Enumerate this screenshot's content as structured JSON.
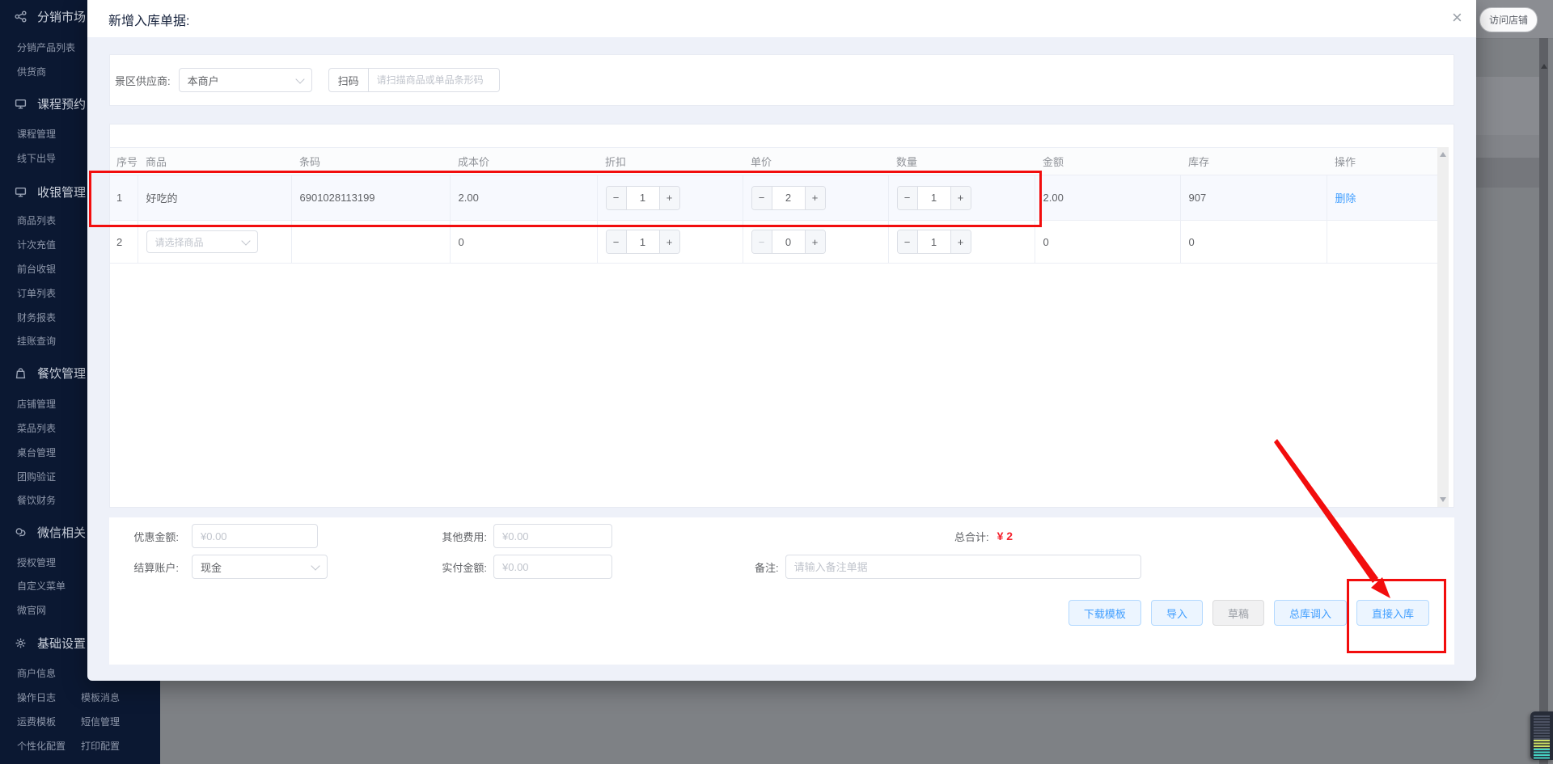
{
  "glyphs": {
    "minus": "−",
    "plus": "+",
    "close": "×"
  },
  "colors": {
    "accent": "#409eff",
    "annotation_red": "#f20d0d",
    "total_red": "#f5222d",
    "sidebar_bg": "#0b1832"
  },
  "topbar": {
    "visit_shop": "访问店铺"
  },
  "sidebar": {
    "sections": [
      {
        "icon": "share-icon",
        "label": "分销市场",
        "items": [
          "分销产品列表",
          "供货商"
        ]
      },
      {
        "icon": "monitor-icon",
        "label": "课程预约",
        "items": [
          "课程管理",
          "线下出导"
        ]
      },
      {
        "icon": "cashier-icon",
        "label": "收银管理",
        "items": [
          "商品列表",
          "计次充值",
          "前台收银",
          "订单列表",
          "财务报表",
          "挂账查询"
        ]
      },
      {
        "icon": "bag-icon",
        "label": "餐饮管理",
        "items": [
          "店铺管理",
          "菜品列表",
          "桌台管理",
          "团购验证",
          "餐饮财务"
        ]
      },
      {
        "icon": "wechat-icon",
        "label": "微信相关",
        "items": [
          "授权管理",
          "自定义菜单",
          "微官网"
        ]
      },
      {
        "icon": "gear-icon",
        "label": "基础设置",
        "items": [
          "商户信息",
          "操作日志",
          "模板消息",
          "运费模板",
          "短信管理",
          "个性化配置",
          "打印配置"
        ]
      }
    ]
  },
  "modal": {
    "title": "新增入库单据:",
    "supplier_label": "景区供应商:",
    "supplier_value": "本商户",
    "scan_button": "扫码",
    "scan_placeholder": "请扫描商品或单品条形码",
    "table": {
      "headers": [
        "序号",
        "商品",
        "条码",
        "成本价",
        "折扣",
        "单价",
        "数量",
        "金额",
        "库存",
        "操作"
      ],
      "rows": [
        {
          "no": "1",
          "product": "好吃的",
          "barcode": "6901028113199",
          "cost": "2.00",
          "discount": "1",
          "price": "2",
          "qty": "1",
          "amount": "2.00",
          "stock": "907",
          "action": "删除"
        },
        {
          "no": "2",
          "product_placeholder": "请选择商品",
          "barcode": "",
          "cost": "0",
          "discount": "1",
          "price": "0",
          "qty": "1",
          "amount": "0",
          "stock": "0",
          "action": ""
        }
      ]
    },
    "form": {
      "discount_label": "优惠金额:",
      "discount_placeholder": "¥0.00",
      "other_fee_label": "其他费用:",
      "other_fee_placeholder": "¥0.00",
      "total_label": "总合计:",
      "total_value": "¥ 2",
      "account_label": "结算账户:",
      "account_value": "现金",
      "paid_label": "实付金额:",
      "paid_placeholder": "¥0.00",
      "remark_label": "备注:",
      "remark_placeholder": "请输入备注单据"
    },
    "buttons": {
      "download_template": "下载模板",
      "import": "导入",
      "draft": "草稿",
      "warehouse_in": "总库调入",
      "direct_in": "直接入库"
    }
  }
}
